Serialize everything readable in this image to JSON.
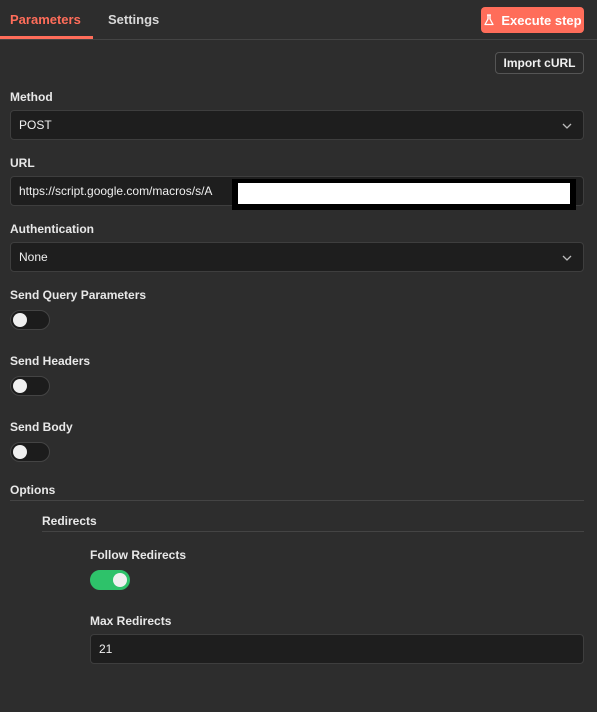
{
  "tabs": {
    "parameters": "Parameters",
    "settings": "Settings"
  },
  "toolbar": {
    "execute_label": "Execute step",
    "import_label": "Import cURL"
  },
  "method": {
    "label": "Method",
    "value": "POST"
  },
  "url": {
    "label": "URL",
    "value": "https://script.google.com/macros/s/A"
  },
  "authentication": {
    "label": "Authentication",
    "value": "None"
  },
  "send_query": {
    "label": "Send Query Parameters",
    "enabled": false
  },
  "send_headers": {
    "label": "Send Headers",
    "enabled": false
  },
  "send_body": {
    "label": "Send Body",
    "enabled": false
  },
  "options": {
    "label": "Options",
    "redirects": {
      "label": "Redirects",
      "follow_label": "Follow Redirects",
      "follow_enabled": true,
      "max_label": "Max Redirects",
      "max_value": "21"
    }
  },
  "colors": {
    "accent": "#ff6d5a",
    "toggle_on": "#2ec26a",
    "background": "#2d2d2d"
  }
}
